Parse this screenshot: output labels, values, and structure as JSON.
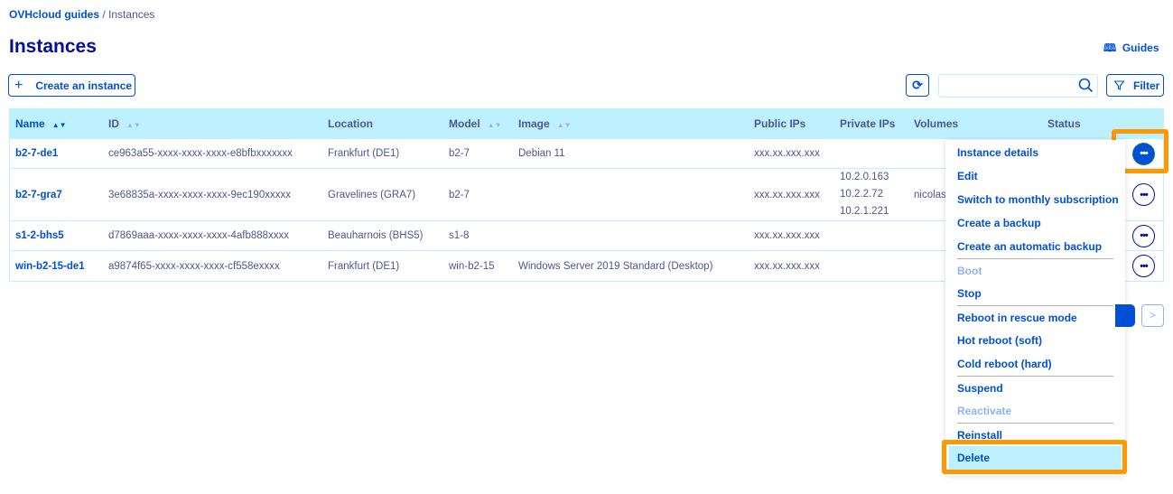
{
  "breadcrumb": {
    "root": "OVHcloud guides",
    "separator": "/",
    "current": "Instances"
  },
  "page_title": "Instances",
  "guides_label": "Guides",
  "toolbar": {
    "create_label": "Create an instance",
    "filter_label": "Filter",
    "search_value": "",
    "search_placeholder": ""
  },
  "table": {
    "columns": [
      "Name",
      "ID",
      "Location",
      "Model",
      "Image",
      "Public IPs",
      "Private IPs",
      "Volumes",
      "Status"
    ],
    "rows": [
      {
        "name": "b2-7-de1",
        "id": "ce963a55-xxxx-xxxx-xxxx-e8bfbxxxxxxx",
        "location": "Frankfurt (DE1)",
        "model": "b2-7",
        "image": "Debian 11",
        "public_ip": "xxx.xx.xxx.xxx",
        "private_ips": [],
        "volumes": "",
        "status": ""
      },
      {
        "name": "b2-7-gra7",
        "id": "3e68835a-xxxx-xxxx-xxxx-9ec190xxxxx",
        "location": "Gravelines (GRA7)",
        "model": "b2-7",
        "image": "",
        "public_ip": "xxx.xx.xxx.xxx",
        "private_ips": [
          "10.2.0.163",
          "10.2.2.72",
          "10.2.1.221"
        ],
        "volumes": "nicolas",
        "status": ""
      },
      {
        "name": "s1-2-bhs5",
        "id": "d7869aaa-xxxx-xxxx-xxxx-4afb888xxxx",
        "location": "Beauharnois (BHS5)",
        "model": "s1-8",
        "image": "",
        "public_ip": "xxx.xx.xxx.xxx",
        "private_ips": [],
        "volumes": "",
        "status": ""
      },
      {
        "name": "win-b2-15-de1",
        "id": "a9874f65-xxxx-xxxx-xxxx-cf558exxxx",
        "location": "Frankfurt (DE1)",
        "model": "win-b2-15",
        "image": "Windows Server 2019 Standard (Desktop)",
        "public_ip": "xxx.xx.xxx.xxx",
        "private_ips": [],
        "volumes": "",
        "status": ""
      }
    ]
  },
  "menu": {
    "items": [
      {
        "label": "Instance details"
      },
      {
        "label": "Edit"
      },
      {
        "label": "Switch to monthly subscription"
      },
      {
        "label": "Create a backup"
      },
      {
        "label": "Create an automatic backup"
      },
      {
        "label": "Boot",
        "disabled": true
      },
      {
        "label": "Stop"
      },
      {
        "label": "Reboot in rescue mode"
      },
      {
        "label": "Hot reboot (soft)"
      },
      {
        "label": "Cold reboot (hard)"
      },
      {
        "label": "Suspend"
      },
      {
        "label": "Reactivate",
        "disabled": true
      },
      {
        "label": "Reinstall"
      },
      {
        "label": "Delete",
        "highlighted": true
      }
    ]
  },
  "pagination": {
    "next": ">"
  },
  "colors": {
    "accent": "#0050d7",
    "header_bg": "#bef1ff",
    "title": "#000e9c",
    "highlight": "#ff9803"
  }
}
